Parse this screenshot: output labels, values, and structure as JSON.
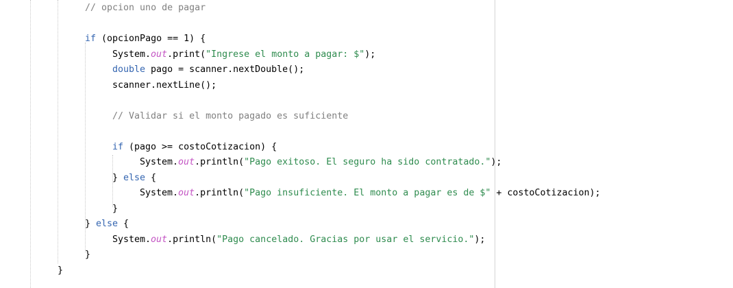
{
  "editor": {
    "lines": [
      {
        "indent": 15,
        "tokens": [
          {
            "t": "// opcion uno de pagar",
            "k": "comment"
          }
        ]
      },
      {
        "indent": 15,
        "tokens": []
      },
      {
        "indent": 15,
        "tokens": [
          {
            "t": "if",
            "k": "keyword"
          },
          {
            "t": " (opcionPago == 1) {",
            "k": "plain"
          }
        ]
      },
      {
        "indent": 20,
        "tokens": [
          {
            "t": "System.",
            "k": "plain"
          },
          {
            "t": "out",
            "k": "field"
          },
          {
            "t": ".print(",
            "k": "plain"
          },
          {
            "t": "\"Ingrese el monto a pagar: $\"",
            "k": "string"
          },
          {
            "t": ");",
            "k": "plain"
          }
        ]
      },
      {
        "indent": 20,
        "tokens": [
          {
            "t": "double",
            "k": "keyword"
          },
          {
            "t": " pago = scanner.nextDouble();",
            "k": "plain"
          }
        ]
      },
      {
        "indent": 20,
        "tokens": [
          {
            "t": "scanner.nextLine();",
            "k": "plain"
          }
        ]
      },
      {
        "indent": 20,
        "tokens": []
      },
      {
        "indent": 20,
        "tokens": [
          {
            "t": "// Validar si el monto pagado es suficiente",
            "k": "comment"
          }
        ]
      },
      {
        "indent": 20,
        "tokens": []
      },
      {
        "indent": 20,
        "tokens": [
          {
            "t": "if",
            "k": "keyword"
          },
          {
            "t": " (pago >= costoCotizacion) {",
            "k": "plain"
          }
        ]
      },
      {
        "indent": 25,
        "tokens": [
          {
            "t": "System.",
            "k": "plain"
          },
          {
            "t": "out",
            "k": "field"
          },
          {
            "t": ".println(",
            "k": "plain"
          },
          {
            "t": "\"Pago exitoso. El seguro ha sido contratado.\"",
            "k": "string"
          },
          {
            "t": ");",
            "k": "plain"
          }
        ]
      },
      {
        "indent": 20,
        "tokens": [
          {
            "t": "} ",
            "k": "plain"
          },
          {
            "t": "else",
            "k": "keyword"
          },
          {
            "t": " {",
            "k": "plain"
          }
        ]
      },
      {
        "indent": 25,
        "tokens": [
          {
            "t": "System.",
            "k": "plain"
          },
          {
            "t": "out",
            "k": "field"
          },
          {
            "t": ".println(",
            "k": "plain"
          },
          {
            "t": "\"Pago insuficiente. El monto a pagar es de $\"",
            "k": "string"
          },
          {
            "t": " + costoCotizacion);",
            "k": "plain"
          }
        ]
      },
      {
        "indent": 20,
        "tokens": [
          {
            "t": "}",
            "k": "plain"
          }
        ]
      },
      {
        "indent": 15,
        "tokens": [
          {
            "t": "} ",
            "k": "plain"
          },
          {
            "t": "else",
            "k": "keyword"
          },
          {
            "t": " {",
            "k": "plain"
          }
        ]
      },
      {
        "indent": 20,
        "tokens": [
          {
            "t": "System.",
            "k": "plain"
          },
          {
            "t": "out",
            "k": "field"
          },
          {
            "t": ".println(",
            "k": "plain"
          },
          {
            "t": "\"Pago cancelado. Gracias por usar el servicio.\"",
            "k": "string"
          },
          {
            "t": ");",
            "k": "plain"
          }
        ]
      },
      {
        "indent": 15,
        "tokens": [
          {
            "t": "}",
            "k": "plain"
          }
        ]
      },
      {
        "indent": 10,
        "tokens": [
          {
            "t": "}",
            "k": "plain"
          }
        ]
      }
    ]
  },
  "colors": {
    "comment": "#808080",
    "keyword": "#3465b0",
    "string": "#2e8b4e",
    "field": "#c354c3",
    "plain": "#000000"
  }
}
